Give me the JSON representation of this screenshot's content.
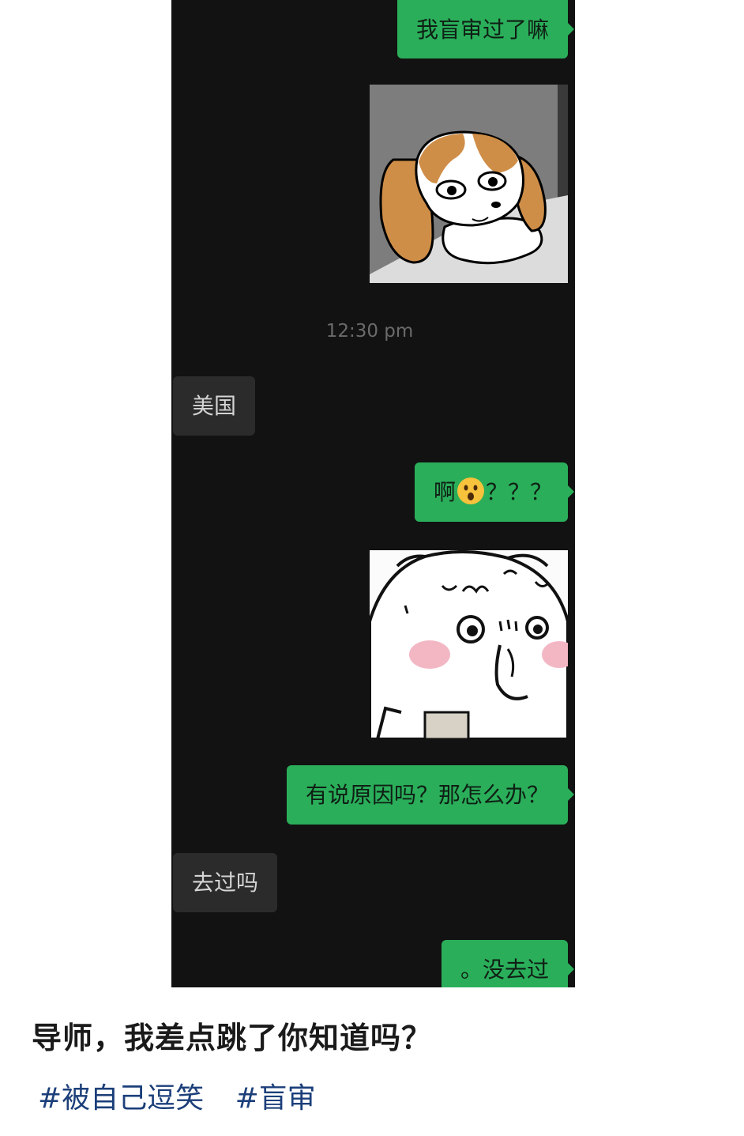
{
  "chat": {
    "messages": [
      {
        "side": "me",
        "kind": "text",
        "text": "我盲审过了嘛"
      },
      {
        "side": "me",
        "kind": "sticker",
        "sticker": "beagle-dog-sticker"
      },
      {
        "kind": "time",
        "text": "12:30 pm"
      },
      {
        "side": "them",
        "kind": "text",
        "text": "美国"
      },
      {
        "side": "me",
        "kind": "text",
        "text_before": "啊",
        "emoji": "surprised-face-emoji",
        "text_after": "？？？"
      },
      {
        "side": "me",
        "kind": "sticker",
        "sticker": "confused-white-cat-sticker"
      },
      {
        "side": "me",
        "kind": "text",
        "text": "有说原因吗？那怎么办？"
      },
      {
        "side": "them",
        "kind": "text",
        "text": "去过吗"
      },
      {
        "side": "me",
        "kind": "text",
        "text": "。没去过"
      }
    ]
  },
  "post": {
    "caption": "导师，我差点跳了你知道吗？",
    "tags": [
      "#被自己逗笑",
      "#盲审"
    ]
  },
  "colors": {
    "chat_background": "#121212",
    "my_bubble": "#2aae5a",
    "their_bubble": "#2b2b2b",
    "tag_color": "#1c3f7a"
  }
}
